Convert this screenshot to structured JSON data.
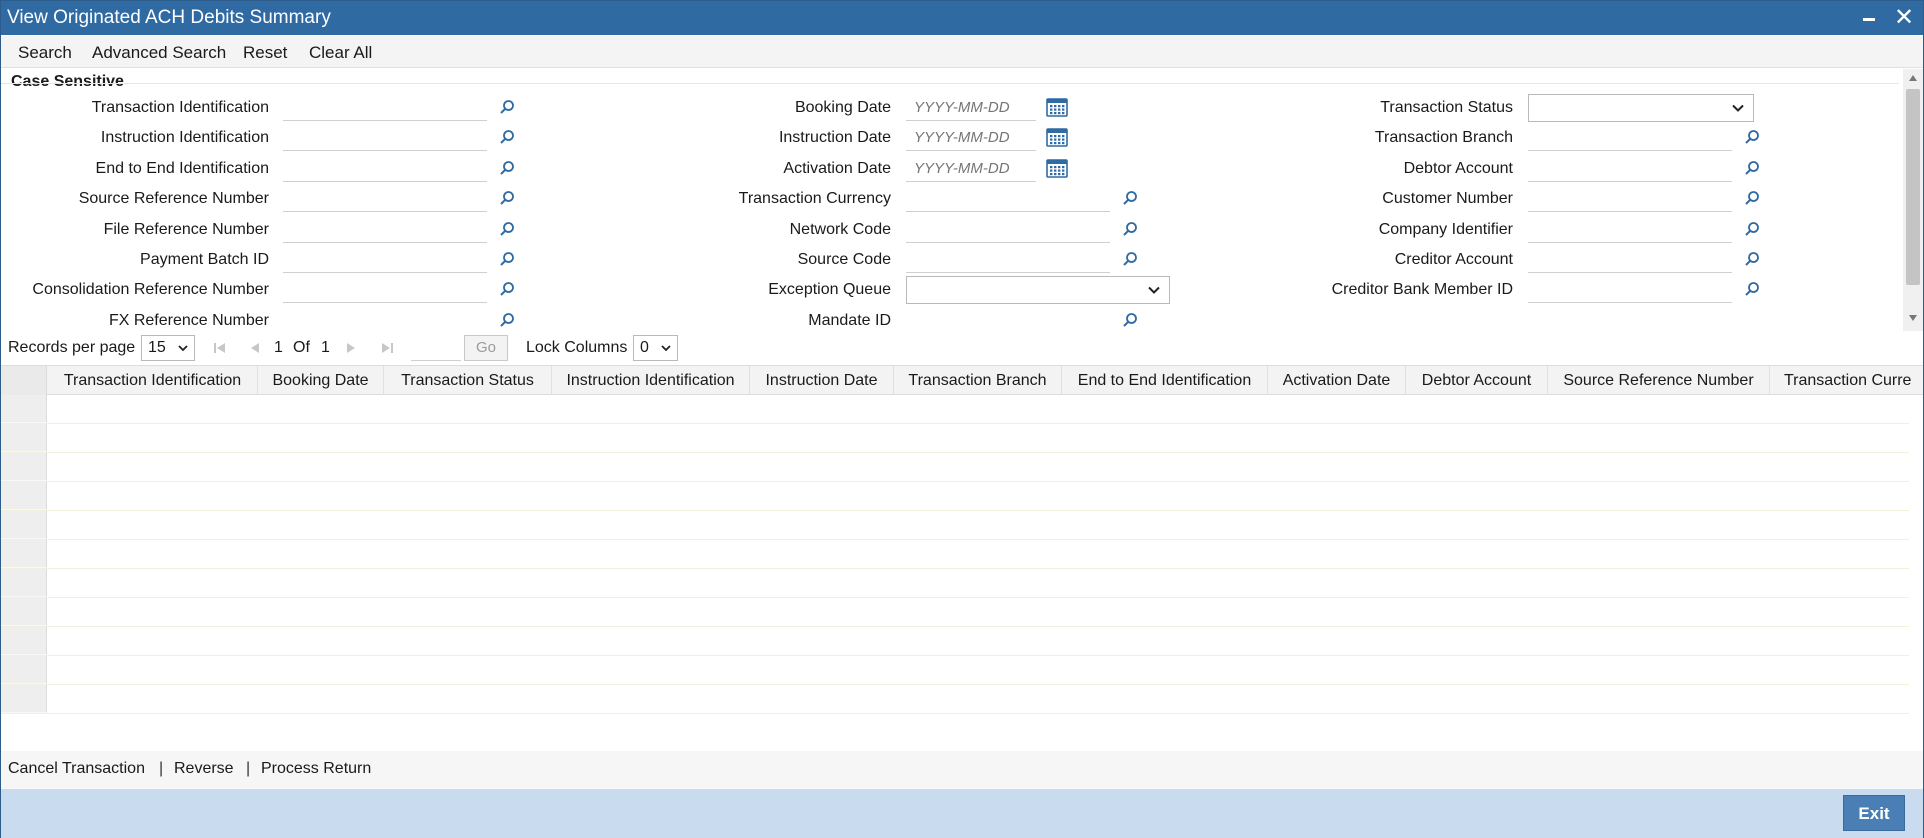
{
  "window": {
    "title": "View Originated ACH Debits Summary"
  },
  "toolbar": {
    "search": "Search",
    "advanced_search": "Advanced Search",
    "reset": "Reset",
    "clear_all": "Clear All"
  },
  "criteria": {
    "case_sensitive": "Case Sensitive",
    "column1": [
      {
        "label": "Transaction Identification",
        "value": ""
      },
      {
        "label": "Instruction Identification",
        "value": ""
      },
      {
        "label": "End to End Identification",
        "value": ""
      },
      {
        "label": "Source Reference Number",
        "value": ""
      },
      {
        "label": "File Reference Number",
        "value": ""
      },
      {
        "label": "Payment Batch ID",
        "value": ""
      },
      {
        "label": "Consolidation Reference Number",
        "value": ""
      },
      {
        "label": "FX Reference Number",
        "value": ""
      }
    ],
    "column2": [
      {
        "label": "Booking Date",
        "placeholder": "YYYY-MM-DD"
      },
      {
        "label": "Instruction Date",
        "placeholder": "YYYY-MM-DD"
      },
      {
        "label": "Activation Date",
        "placeholder": "YYYY-MM-DD"
      },
      {
        "label": "Transaction Currency",
        "value": ""
      },
      {
        "label": "Network Code",
        "value": ""
      },
      {
        "label": "Source Code",
        "value": ""
      },
      {
        "label": "Exception Queue",
        "value": ""
      },
      {
        "label": "Mandate ID",
        "value": ""
      }
    ],
    "column3": [
      {
        "label": "Transaction Status",
        "value": ""
      },
      {
        "label": "Transaction Branch",
        "value": ""
      },
      {
        "label": "Debtor Account",
        "value": ""
      },
      {
        "label": "Customer Number",
        "value": ""
      },
      {
        "label": "Company Identifier",
        "value": ""
      },
      {
        "label": "Creditor Account",
        "value": ""
      },
      {
        "label": "Creditor Bank Member ID",
        "value": ""
      }
    ]
  },
  "pager": {
    "records_per_page_label": "Records per page",
    "records_per_page": "15",
    "current_page": "1",
    "of_label": "Of",
    "total_pages": "1",
    "go_label": "Go",
    "lock_columns_label": "Lock Columns",
    "lock_columns": "0"
  },
  "grid": {
    "columns": [
      "Transaction Identification",
      "Booking Date",
      "Transaction Status",
      "Instruction Identification",
      "Instruction Date",
      "Transaction Branch",
      "End to End Identification",
      "Activation Date",
      "Debtor Account",
      "Source Reference Number",
      "Transaction Curre"
    ],
    "row_count": 11
  },
  "actions": {
    "cancel_transaction": "Cancel Transaction",
    "reverse": "Reverse",
    "process_return": "Process Return",
    "separator": "|"
  },
  "footer": {
    "exit": "Exit"
  },
  "colors": {
    "title_bar": "#2f6aa3",
    "footer": "#c9dcef",
    "exit_button": "#4a7fb5",
    "icon_blue": "#2f6aa3"
  },
  "icons": {
    "lookup": "search-icon",
    "date": "calendar-icon",
    "dropdown": "chevron-down-icon",
    "close": "close-icon",
    "minimize": "minimize-icon"
  }
}
